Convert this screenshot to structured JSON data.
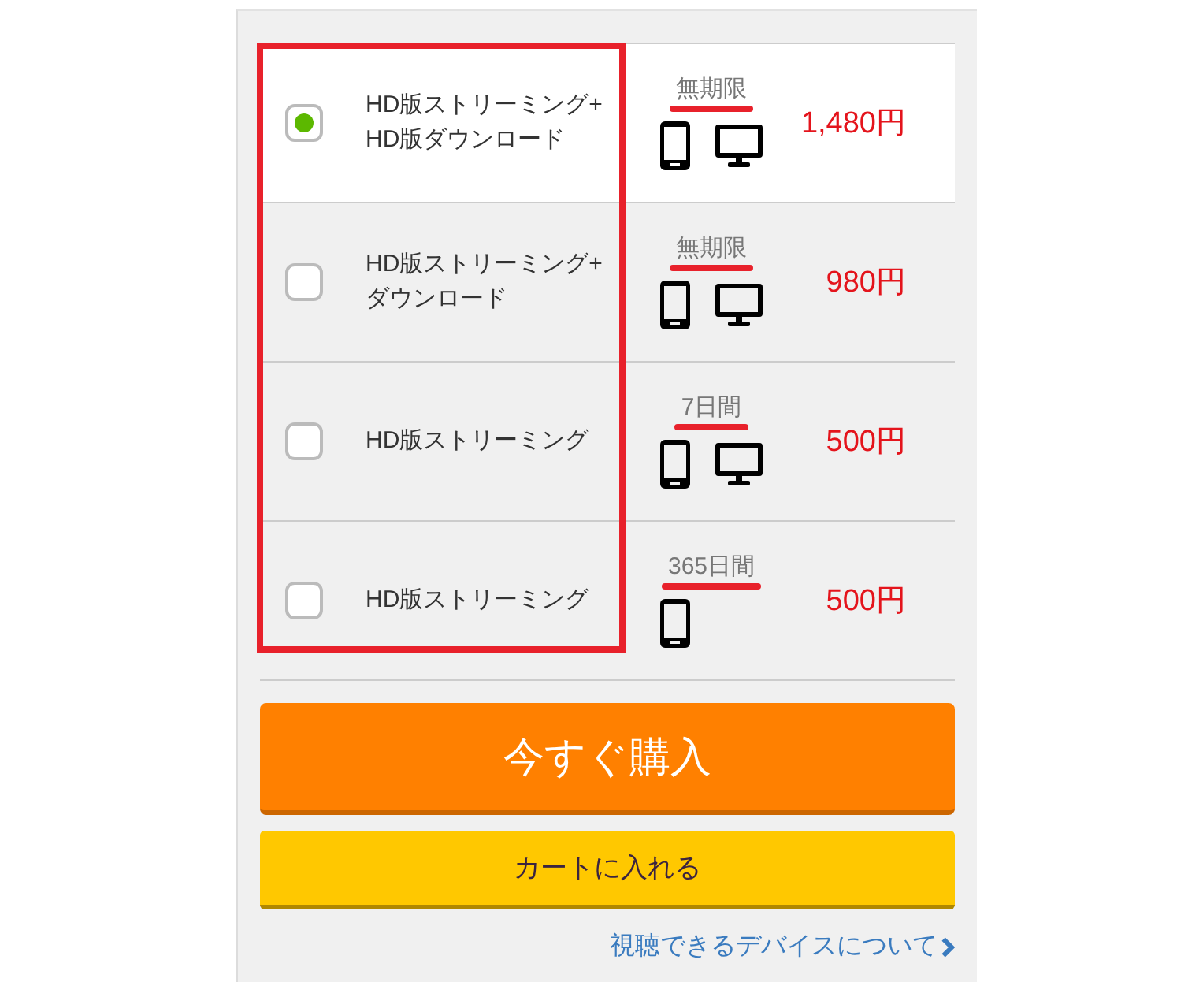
{
  "highlight_frame": true,
  "options": [
    {
      "label": "HD版ストリーミング+\nHD版ダウンロード",
      "selected": true,
      "period": "無期限",
      "period_highlighted": true,
      "devices": [
        {
          "kind": "phone"
        },
        {
          "kind": "monitor"
        }
      ],
      "price": "1,480円"
    },
    {
      "label": "HD版ストリーミング+\nダウンロード",
      "selected": false,
      "period": "無期限",
      "period_highlighted": true,
      "devices": [
        {
          "kind": "phone"
        },
        {
          "kind": "monitor"
        }
      ],
      "price": "980円"
    },
    {
      "label": "HD版ストリーミング",
      "selected": false,
      "period": "7日間",
      "period_highlighted": true,
      "devices": [
        {
          "kind": "phone"
        },
        {
          "kind": "monitor"
        }
      ],
      "price": "500円"
    },
    {
      "label": "HD版ストリーミング",
      "selected": false,
      "period": "365日間",
      "period_highlighted": true,
      "devices": [
        {
          "kind": "phone"
        }
      ],
      "price": "500円"
    }
  ],
  "buy_now_button": "今すぐ購入",
  "add_to_cart_button": "カートに入れる",
  "devices_link": "視聴できるデバイスについて"
}
